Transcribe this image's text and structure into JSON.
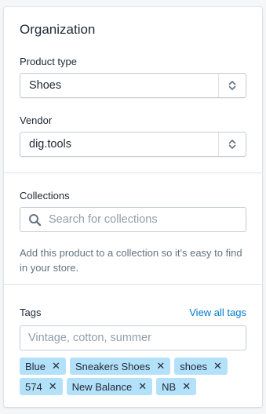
{
  "organization": {
    "title": "Organization",
    "product_type": {
      "label": "Product type",
      "value": "Shoes"
    },
    "vendor": {
      "label": "Vendor",
      "value": "dig.tools"
    }
  },
  "collections": {
    "label": "Collections",
    "search_placeholder": "Search for collections",
    "help_text": "Add this product to a collection so it's easy to find in your store."
  },
  "tags": {
    "label": "Tags",
    "view_all_link": "View all tags",
    "input_placeholder": "Vintage, cotton, summer",
    "remove_glyph": "✕",
    "items": [
      "Blue",
      "Sneakers Shoes",
      "shoes",
      "574",
      "New Balance",
      "NB"
    ]
  }
}
